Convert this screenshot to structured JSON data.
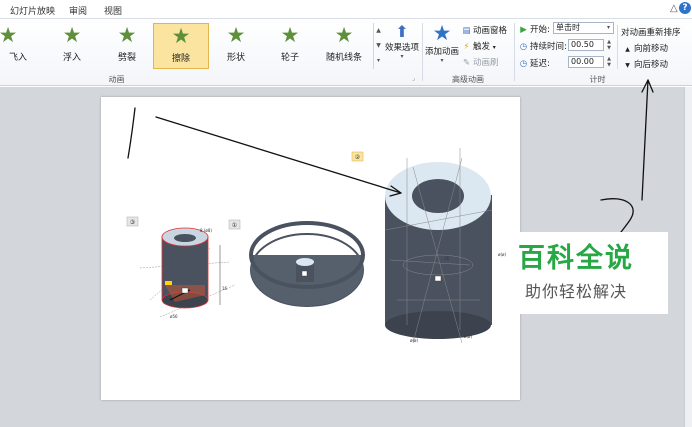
{
  "tabs": [
    "幻灯片放映",
    "审阅",
    "视图"
  ],
  "window": {
    "help": "?",
    "minimize": "△"
  },
  "effects": [
    {
      "label": "飞入",
      "selected": false
    },
    {
      "label": "浮入",
      "selected": false
    },
    {
      "label": "劈裂",
      "selected": false
    },
    {
      "label": "擦除",
      "selected": true
    },
    {
      "label": "形状",
      "selected": false
    },
    {
      "label": "轮子",
      "selected": false
    },
    {
      "label": "随机线条",
      "selected": false
    }
  ],
  "effect_options": "效果选项",
  "groups": {
    "animation": "动画",
    "advanced": "高级动画",
    "timing": "计时"
  },
  "advanced": {
    "add_animation": "添加动画",
    "pane": "动画窗格",
    "trigger": "触发",
    "painter": "动画刷"
  },
  "timing": {
    "start_label": "开始:",
    "start_value": "单击时",
    "duration_label": "持续时间:",
    "duration_value": "00.50",
    "delay_label": "延迟:",
    "delay_value": "00.00"
  },
  "reorder": {
    "title": "对动画重新排序",
    "earlier": "向前移动",
    "later": "向后移动"
  },
  "slide": {
    "badges": [
      "③",
      "①",
      "②"
    ],
    "dims": {
      "d1": "8 (ø8)",
      "d2": "16",
      "d3": "ø56",
      "d4": "ø(ø)"
    }
  },
  "watermark": {
    "title": "百科全说",
    "subtitle": "助你轻松解决"
  },
  "colors": {
    "accent": "#28a745",
    "selected_effect": "#fbe3a0",
    "star": "#5e8f3a"
  }
}
